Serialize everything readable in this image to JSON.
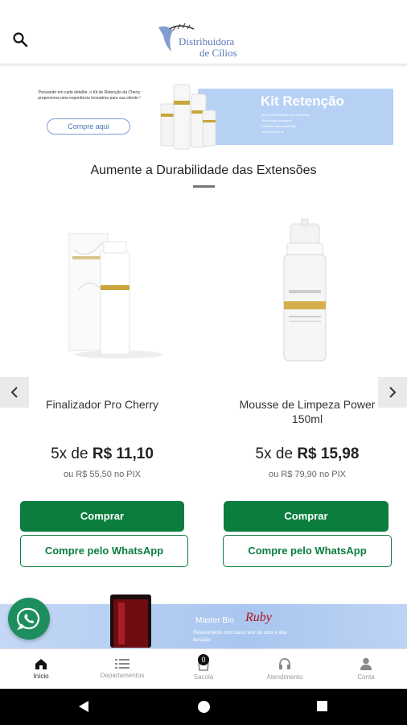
{
  "header": {
    "logo_line1": "Distribuidora",
    "logo_line2": "de Cílios"
  },
  "banner": {
    "left_text": "Pensando em cada detalhe, o Kit de Retenção da Cherry proporciona uma experiência inovadora para sua cliente !",
    "cta_label": "Compre aqui",
    "title": "Kit Retenção",
    "bullets": [
      "Maior durabilidade das extensões",
      "Tecnologia inovadora",
      "Clientes mais satisfeitas",
      "Aumenta lucros"
    ]
  },
  "section": {
    "title": "Aumente a Durabilidade das Extensões"
  },
  "products": [
    {
      "name": "Finalizador Pro Cherry",
      "installments_prefix": "5x de ",
      "installment_value": "R$ 11,10",
      "pix_text": "ou R$ 55,50 no PIX",
      "buy_label": "Comprar",
      "whatsapp_label": "Compre pelo WhatsApp"
    },
    {
      "name": "Mousse de Limpeza Power 150ml",
      "installments_prefix": "5x de ",
      "installment_value": "R$ 15,98",
      "pix_text": "ou R$ 79,90 no PIX",
      "buy_label": "Comprar",
      "whatsapp_label": "Compre pelo WhatsApp"
    }
  ],
  "bottom_banner": {
    "title": "Master Bio",
    "brand": "Ruby",
    "subtitle": "Revestimento com baixo teor de odor e alta duração"
  },
  "tabs": [
    {
      "label": "Início",
      "icon": "home-icon",
      "active": true
    },
    {
      "label": "Departamentos",
      "icon": "list-icon",
      "active": false
    },
    {
      "label": "Sacola",
      "icon": "bag-icon",
      "active": false,
      "badge": "0"
    },
    {
      "label": "Atendimento",
      "icon": "headset-icon",
      "active": false
    },
    {
      "label": "Conta",
      "icon": "user-icon",
      "active": false
    }
  ],
  "colors": {
    "primary_green": "#0b7d3e",
    "whatsapp_green": "#1f8e5f",
    "banner_blue": "#b7d1f5",
    "logo_blue": "#5a78b8"
  }
}
